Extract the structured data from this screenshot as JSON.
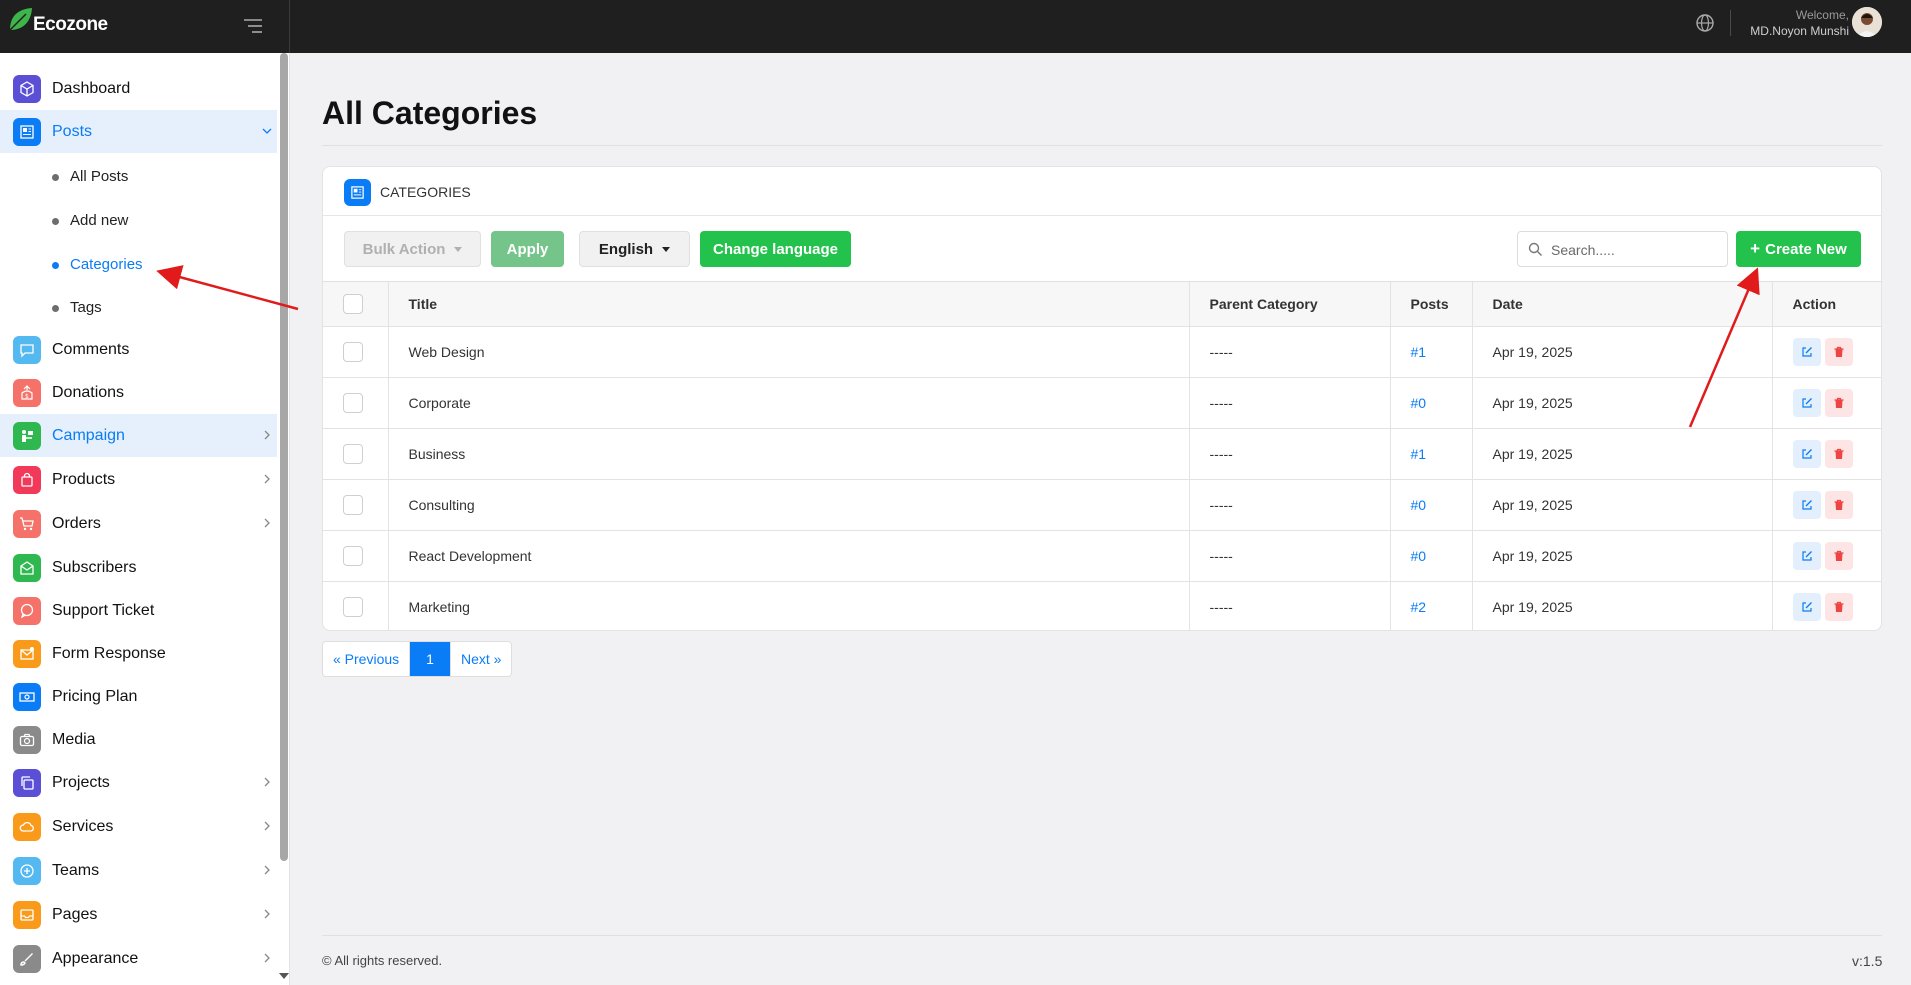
{
  "app": {
    "name": "Ecozone"
  },
  "topbar": {
    "welcome": "Welcome,",
    "username": "MD.Noyon Munshi"
  },
  "sidebar": {
    "items": [
      {
        "label": "Dashboard",
        "icon": "cube-icon",
        "color": "#5b4fd6"
      },
      {
        "label": "Posts",
        "icon": "newspaper-icon",
        "color": "#0a7cf5",
        "active": true,
        "expanded": true
      },
      {
        "label": "Comments",
        "icon": "comment-icon",
        "color": "#54b9f0"
      },
      {
        "label": "Donations",
        "icon": "donation-icon",
        "color": "#f4726a"
      },
      {
        "label": "Campaign",
        "icon": "campaign-icon",
        "color": "#2fb84f",
        "active": true
      },
      {
        "label": "Products",
        "icon": "bag-icon",
        "color": "#f2395a"
      },
      {
        "label": "Orders",
        "icon": "cart-icon",
        "color": "#f4726a"
      },
      {
        "label": "Subscribers",
        "icon": "mail-open-icon",
        "color": "#2fb84f"
      },
      {
        "label": "Support Ticket",
        "icon": "chat-icon",
        "color": "#f4726a"
      },
      {
        "label": "Form Response",
        "icon": "mail-icon",
        "color": "#fa9a1a"
      },
      {
        "label": "Pricing Plan",
        "icon": "money-icon",
        "color": "#0a7cf5"
      },
      {
        "label": "Media",
        "icon": "camera-icon",
        "color": "#8a8a8a"
      },
      {
        "label": "Projects",
        "icon": "copy-icon",
        "color": "#5b4fd6"
      },
      {
        "label": "Services",
        "icon": "cloud-icon",
        "color": "#fa9a1a"
      },
      {
        "label": "Teams",
        "icon": "plus-circle-icon",
        "color": "#54b9f0"
      },
      {
        "label": "Pages",
        "icon": "inbox-icon",
        "color": "#fa9a1a"
      },
      {
        "label": "Appearance",
        "icon": "brush-icon",
        "color": "#8a8a8a"
      }
    ],
    "posts_sub": [
      {
        "label": "All Posts"
      },
      {
        "label": "Add new"
      },
      {
        "label": "Categories",
        "active": true
      },
      {
        "label": "Tags"
      }
    ]
  },
  "main": {
    "title": "All Categories",
    "card_label": "CATEGORIES",
    "toolbar": {
      "bulk_action": "Bulk Action",
      "apply": "Apply",
      "language": "English",
      "change_language": "Change language",
      "search_placeholder": "Search.....",
      "create_new": "Create New"
    },
    "table": {
      "headers": [
        "Title",
        "Parent Category",
        "Posts",
        "Date",
        "Action"
      ],
      "rows": [
        {
          "title": "Web Design",
          "parent": "-----",
          "posts": "#1",
          "date": "Apr 19, 2025"
        },
        {
          "title": "Corporate",
          "parent": "-----",
          "posts": "#0",
          "date": "Apr 19, 2025"
        },
        {
          "title": "Business",
          "parent": "-----",
          "posts": "#1",
          "date": "Apr 19, 2025"
        },
        {
          "title": "Consulting",
          "parent": "-----",
          "posts": "#0",
          "date": "Apr 19, 2025"
        },
        {
          "title": "React Development",
          "parent": "-----",
          "posts": "#0",
          "date": "Apr 19, 2025"
        },
        {
          "title": "Marketing",
          "parent": "-----",
          "posts": "#2",
          "date": "Apr 19, 2025"
        }
      ]
    },
    "pagination": {
      "prev": "« Previous",
      "current": "1",
      "next": "Next »"
    }
  },
  "footer": {
    "copyright": "© All rights reserved.",
    "version": "v:1.5"
  },
  "colors": {
    "accent": "#0a7cf5",
    "success": "#22c24c",
    "danger": "#ef4444",
    "topbar": "#1f1f1f"
  }
}
